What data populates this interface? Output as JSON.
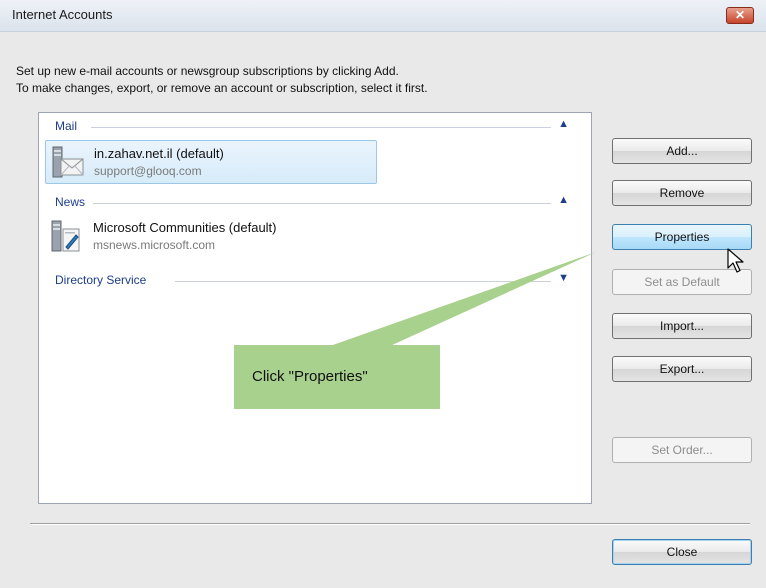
{
  "window": {
    "title": "Internet Accounts",
    "close_glyph": "✕"
  },
  "instructions": {
    "line1": "Set up new e-mail accounts or newsgroup subscriptions by clicking Add.",
    "line2": "To make changes, export, or remove an account or subscription, select it first."
  },
  "groups": {
    "mail": {
      "label": "Mail",
      "state": "expanded",
      "accounts": [
        {
          "name": "in.zahav.net.il (default)",
          "detail": "support@glooq.com",
          "selected": true,
          "icon": "mail-account-icon"
        }
      ]
    },
    "news": {
      "label": "News",
      "state": "expanded",
      "accounts": [
        {
          "name": "Microsoft Communities (default)",
          "detail": "msnews.microsoft.com",
          "selected": false,
          "icon": "news-account-icon"
        }
      ]
    },
    "directory": {
      "label": "Directory Service",
      "state": "collapsed"
    }
  },
  "buttons": {
    "add": "Add...",
    "remove": "Remove",
    "properties": "Properties",
    "set_default": "Set as Default",
    "import": "Import...",
    "export": "Export...",
    "set_order": "Set Order...",
    "close": "Close"
  },
  "callout": {
    "text": "Click \"Properties\"",
    "color": "#a9d18e"
  }
}
